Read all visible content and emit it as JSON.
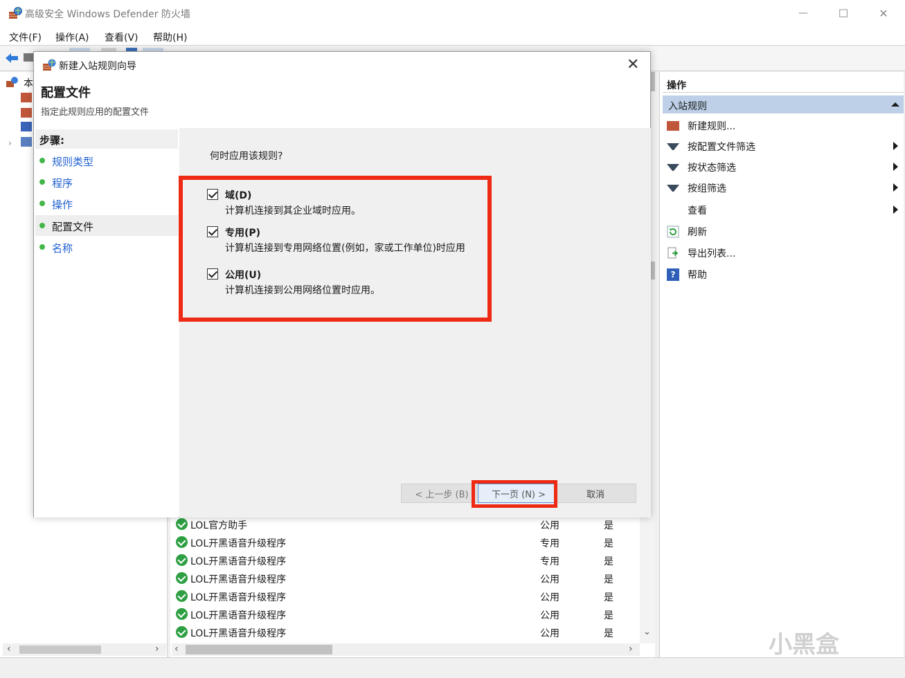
{
  "window": {
    "title": "高级安全 Windows Defender 防火墙",
    "min_glyph": "—",
    "max_glyph": "☐",
    "close_glyph": "✕"
  },
  "menu": [
    "文件(F)",
    "操作(A)",
    "查看(V)",
    "帮助(H)"
  ],
  "left_tree": {
    "root_label": "本",
    "expand_glyph": "›"
  },
  "rules_table": {
    "rows": [
      {
        "name": "LOL官方助手",
        "profile": "公用",
        "enabled": "是"
      },
      {
        "name": "LOL开黑语音升级程序",
        "profile": "专用",
        "enabled": "是"
      },
      {
        "name": "LOL开黑语音升级程序",
        "profile": "专用",
        "enabled": "是"
      },
      {
        "name": "LOL开黑语音升级程序",
        "profile": "公用",
        "enabled": "是"
      },
      {
        "name": "LOL开黑语音升级程序",
        "profile": "公用",
        "enabled": "是"
      },
      {
        "name": "LOL开黑语音升级程序",
        "profile": "公用",
        "enabled": "是"
      },
      {
        "name": "LOL开黑语音升级程序",
        "profile": "公用",
        "enabled": "是"
      }
    ]
  },
  "actions_pane": {
    "header": "操作",
    "section": "入站规则",
    "items": [
      {
        "label": "新建规则...",
        "icon": "new-rule-icon",
        "submenu": false
      },
      {
        "label": "按配置文件筛选",
        "icon": "filter-icon",
        "submenu": true
      },
      {
        "label": "按状态筛选",
        "icon": "filter-icon",
        "submenu": true
      },
      {
        "label": "按组筛选",
        "icon": "filter-icon",
        "submenu": true
      },
      {
        "label": "查看",
        "icon": "",
        "submenu": true
      },
      {
        "label": "刷新",
        "icon": "refresh-icon",
        "submenu": false
      },
      {
        "label": "导出列表...",
        "icon": "export-icon",
        "submenu": false
      },
      {
        "label": "帮助",
        "icon": "help-icon",
        "submenu": false
      }
    ]
  },
  "dialog": {
    "title": "新建入站规则向导",
    "heading": "配置文件",
    "subheading": "指定此规则应用的配置文件",
    "close_glyph": "✕",
    "steps_header": "步骤:",
    "steps": [
      "规则类型",
      "程序",
      "操作",
      "配置文件",
      "名称"
    ],
    "current_step": 3,
    "question": "何时应用该规则?",
    "options": [
      {
        "title": "域(D)",
        "desc": "计算机连接到其企业域时应用。",
        "checked": true
      },
      {
        "title": "专用(P)",
        "desc": "计算机连接到专用网络位置(例如，家或工作单位)时应用",
        "checked": true
      },
      {
        "title": "公用(U)",
        "desc": "计算机连接到公用网络位置时应用。",
        "checked": true
      }
    ],
    "buttons": {
      "back": "< 上一步 (B)",
      "next": "下一页 (N) >",
      "cancel": "取消"
    }
  },
  "scroll": {
    "left_arrow": "‹",
    "right_arrow": "›",
    "down_arrow": "⌄"
  },
  "watermark": "小黑盒",
  "colors": {
    "highlight": "#ee2a14",
    "step_link": "#1f5fd0",
    "section_bg": "#bdd0e8",
    "check_green": "#2ea043"
  }
}
